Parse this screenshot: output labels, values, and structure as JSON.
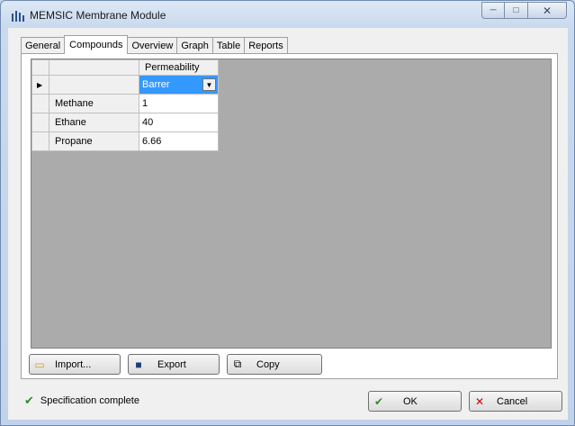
{
  "window": {
    "title": "MEMSIC Membrane Module",
    "caption": {
      "minimize": "─",
      "maximize": "□",
      "close": "✕"
    }
  },
  "tabs": [
    {
      "label": "General"
    },
    {
      "label": "Compounds"
    },
    {
      "label": "Overview"
    },
    {
      "label": "Graph"
    },
    {
      "label": "Table"
    },
    {
      "label": "Reports"
    }
  ],
  "active_tab": "Compounds",
  "grid": {
    "column_header": "Permeability",
    "units_value": "Barrer",
    "rows": [
      {
        "name": "Methane",
        "value": "1"
      },
      {
        "name": "Ethane",
        "value": "40"
      },
      {
        "name": "Propane",
        "value": "6.66"
      }
    ]
  },
  "actions": {
    "import_label": "Import...",
    "export_label": "Export",
    "copy_label": "Copy"
  },
  "status": {
    "text": "Specification complete"
  },
  "footer": {
    "ok_label": "OK",
    "cancel_label": "Cancel"
  },
  "colors": {
    "selection": "#3399ff",
    "grid_bg": "#ababab",
    "ok_check": "#2e8b2e",
    "cancel_x": "#cc0000"
  }
}
